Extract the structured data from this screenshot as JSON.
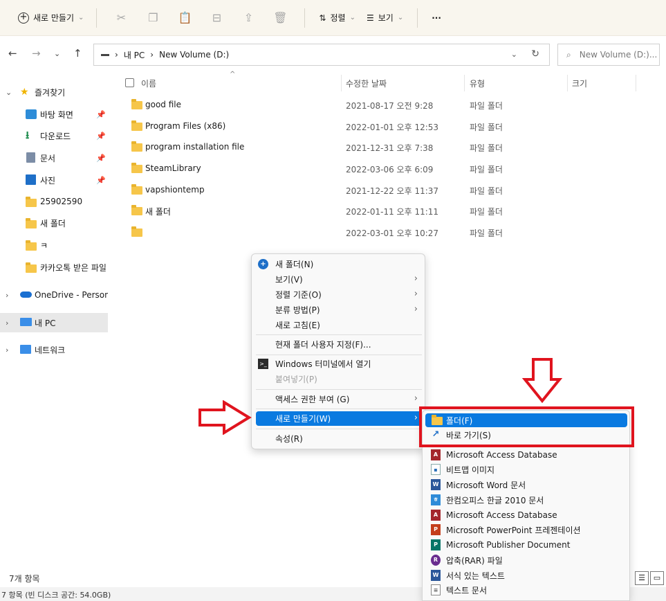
{
  "toolbar": {
    "new_label": "새로 만들기",
    "sort_label": "정렬",
    "view_label": "보기",
    "more_label": "···"
  },
  "address": {
    "crumbs": [
      "내 PC",
      "New Volume (D:)"
    ],
    "search_placeholder": "New Volume (D:)..."
  },
  "sidebar": {
    "quick_access": "즐겨찾기",
    "items": [
      {
        "label": "바탕 화면",
        "pinned": true
      },
      {
        "label": "다운로드",
        "pinned": true
      },
      {
        "label": "문서",
        "pinned": true
      },
      {
        "label": "사진",
        "pinned": true
      },
      {
        "label": "25902590"
      },
      {
        "label": "새 폴더"
      },
      {
        "label": "ㅋ"
      },
      {
        "label": "카카오톡 받은 파일"
      }
    ],
    "onedrive": "OneDrive - Persona",
    "this_pc": "내 PC",
    "network": "네트워크"
  },
  "columns": {
    "name": "이름",
    "date": "수정한 날짜",
    "type": "유형",
    "size": "크기"
  },
  "files": [
    {
      "name": "good file",
      "date": "2021-08-17 오전 9:28",
      "type": "파일 폴더"
    },
    {
      "name": "Program Files (x86)",
      "date": "2022-01-01 오후 12:53",
      "type": "파일 폴더"
    },
    {
      "name": "program installation file",
      "date": "2021-12-31 오후 7:38",
      "type": "파일 폴더"
    },
    {
      "name": "SteamLibrary",
      "date": "2022-03-06 오후 6:09",
      "type": "파일 폴더"
    },
    {
      "name": "vapshiontemp",
      "date": "2021-12-22 오후 11:37",
      "type": "파일 폴더"
    },
    {
      "name": "새 폴더",
      "date": "2022-01-11 오후 11:11",
      "type": "파일 폴더"
    },
    {
      "name": "",
      "date": "2022-03-01 오후 10:27",
      "type": "파일 폴더"
    }
  ],
  "status": {
    "count": "7개 항목",
    "bottom": "7 항목 (빈 디스크 공간: 54.0GB)"
  },
  "context_menu": {
    "new_folder": "새 폴더(N)",
    "view": "보기(V)",
    "sort_by": "정렬 기준(O)",
    "group_by": "분류 방법(P)",
    "refresh": "새로 고침(E)",
    "customize": "현재 폴더 사용자 지정(F)...",
    "terminal": "Windows 터미널에서 열기",
    "paste": "붙여넣기(P)",
    "access": "액세스 권한 부여 (G)",
    "new": "새로 만들기(W)",
    "properties": "속성(R)"
  },
  "submenu": {
    "items": [
      {
        "label": "폴더(F)",
        "icon": "folder-icon"
      },
      {
        "label": "바로 가기(S)",
        "icon": "shortcut-icon"
      },
      {
        "label": "Microsoft Access Database",
        "icon": "access-icon"
      },
      {
        "label": "비트맵 이미지",
        "icon": "bitmap-icon"
      },
      {
        "label": "Microsoft Word 문서",
        "icon": "word-icon"
      },
      {
        "label": "한컴오피스 한글 2010 문서",
        "icon": "hwp-icon"
      },
      {
        "label": "Microsoft Access Database",
        "icon": "access-icon"
      },
      {
        "label": "Microsoft PowerPoint 프레젠테이션",
        "icon": "powerpoint-icon"
      },
      {
        "label": "Microsoft Publisher Document",
        "icon": "publisher-icon"
      },
      {
        "label": "압축(RAR) 파일",
        "icon": "rar-icon"
      },
      {
        "label": "서식 있는 텍스트",
        "icon": "rtf-icon"
      },
      {
        "label": "텍스트 문서",
        "icon": "text-icon"
      }
    ]
  },
  "colors": {
    "highlight": "#0a7ae0",
    "annotation_red": "#e0141e",
    "folder": "#f6c64a"
  }
}
